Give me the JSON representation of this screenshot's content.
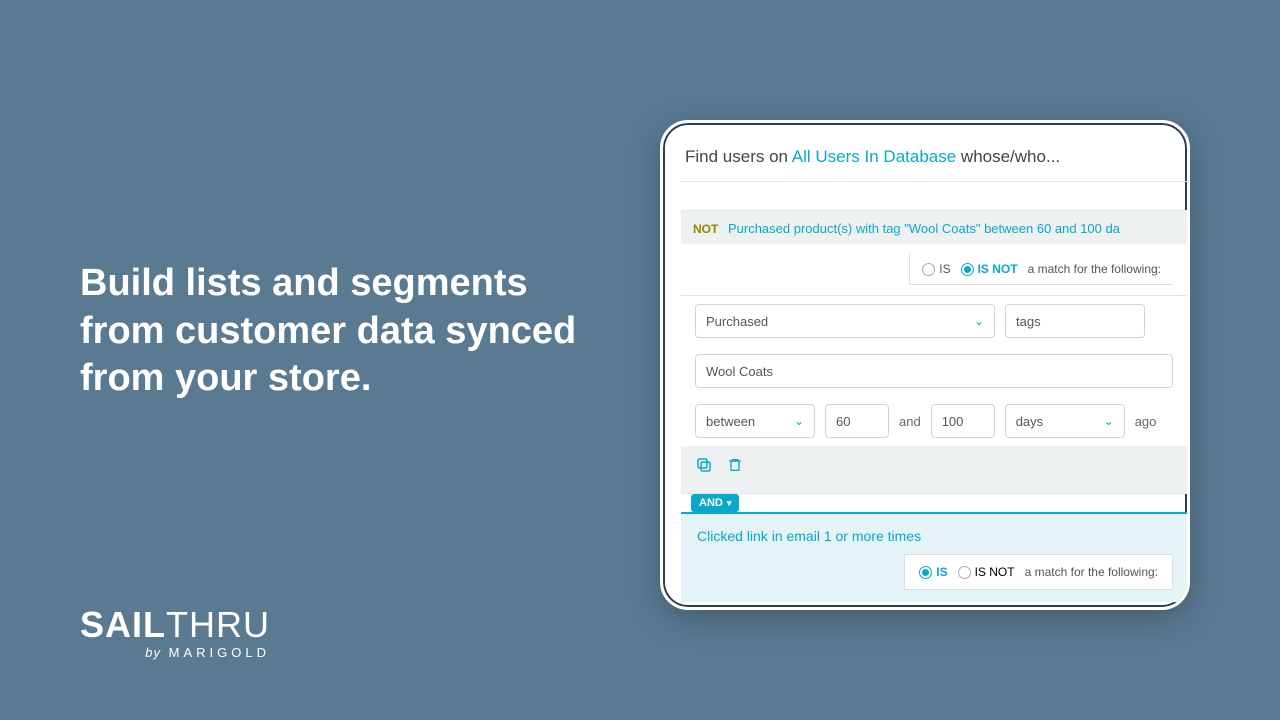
{
  "marketing": {
    "headline": "Build lists and segments from customer data synced from your store.",
    "logo_main_a": "SAIL",
    "logo_main_b": "THRU",
    "logo_by": "by",
    "logo_brand": "MARIGOLD"
  },
  "builder": {
    "header_prefix": "Find users on ",
    "header_link": "All Users In Database",
    "header_suffix": " whose/who...",
    "criteria1": {
      "not_label": "NOT",
      "summary": "Purchased product(s) with tag \"Wool Coats\" between 60 and 100 da",
      "is_label": "IS",
      "isnot_label": "IS NOT",
      "match_text": "a match for the following:",
      "field_action": "Purchased",
      "field_attr": "tags",
      "field_value": "Wool Coats",
      "op": "between",
      "from": "60",
      "and_word": "and",
      "to": "100",
      "unit": "days",
      "ago": "ago"
    },
    "connector": "AND",
    "criteria2": {
      "summary": "Clicked link in email 1 or more times",
      "is_label": "IS",
      "isnot_label": "IS NOT",
      "match_text": "a match for the following:"
    }
  }
}
